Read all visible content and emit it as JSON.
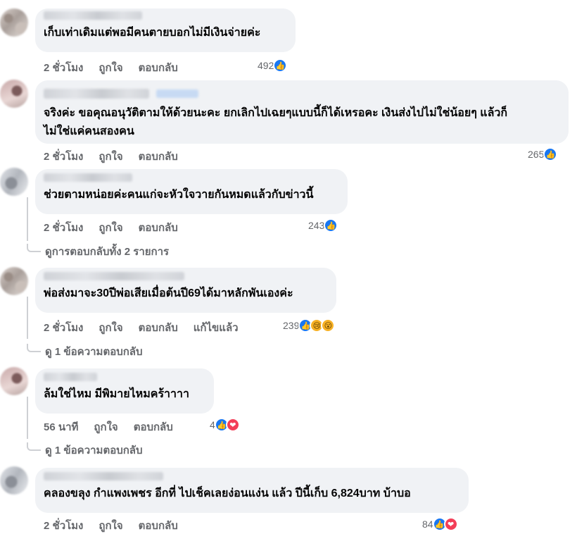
{
  "actions": {
    "like": "ถูกใจ",
    "reply": "ตอบกลับ",
    "edited": "แก้ไขแล้ว"
  },
  "comments": [
    {
      "text": "เก็บเท่าเดิมแต่พอมีคนตายบอกไม่มีเงินจ่ายค่ะ",
      "time": "2 ชั่วโมง",
      "reaction_count": "492",
      "reactions": [
        "like"
      ]
    },
    {
      "text_line1": "จริงค่ะ ขอคุณอนุวัติตามให้ด้วยนะคะ ยกเลิกไปเฉยๆแบบนี้ก็ได้เหรอคะ เงินส่งไปไม่ใช่น้อยๆ แล้วก็",
      "text_line2": "ไม่ใช่แค่คนสองคน",
      "time": "2 ชั่วโมง",
      "reaction_count": "265",
      "reactions": [
        "like"
      ]
    },
    {
      "text": "ช่วยตามหน่อยค่ะคนแก่จะหัวใจวายกันหมดแล้วกับข่าวนี้",
      "time": "2 ชั่วโมง",
      "reaction_count": "243",
      "reactions": [
        "like"
      ],
      "replies_link": "ดูการตอบกลับทั้ง 2 รายการ"
    },
    {
      "text": "พ่อส่งมาจะ30ปีพ่อเสียเมื่อต้นปี69ได้มาหลักพันเองค่ะ",
      "time": "2 ชั่วโมง",
      "edited": true,
      "reaction_count": "239",
      "reactions": [
        "like",
        "sad",
        "wow"
      ],
      "replies_link": "ดู 1 ข้อความตอบกลับ"
    },
    {
      "text": "ล้มใช่ไหม มีพิมายไหมคร้าาาา",
      "time": "56 นาที",
      "reaction_count": "4",
      "reactions": [
        "like",
        "love"
      ],
      "replies_link": "ดู 1 ข้อความตอบกลับ"
    },
    {
      "text": "คลองขลุง กำแพงเพชร อีกที่ ไปเช็คเลยง่อนแง่น แล้ว ปีนี้เก็บ 6,824บาท บ้าบอ",
      "time": "2 ชั่วโมง",
      "reaction_count": "84",
      "reactions": [
        "like",
        "love"
      ]
    }
  ],
  "icons": {
    "like": "like-reaction-icon",
    "sad": "sad-reaction-icon",
    "wow": "wow-reaction-icon",
    "love": "love-reaction-icon"
  },
  "colors": {
    "bubble": "#f0f2f5",
    "meta_text": "#65676b",
    "like_blue": "#1877f2",
    "love_red": "#f33e58",
    "emoji_yellow": "#f7b125"
  }
}
